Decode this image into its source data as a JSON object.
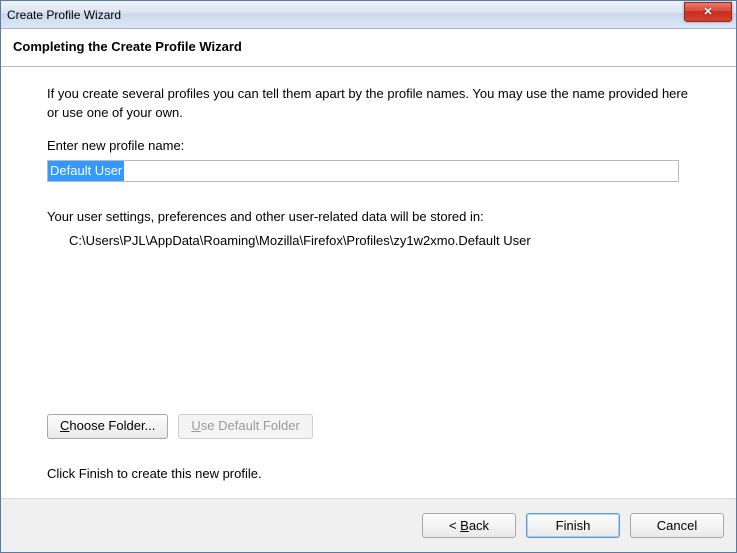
{
  "window": {
    "title": "Create Profile Wizard"
  },
  "header": {
    "subtitle": "Completing the Create Profile Wizard"
  },
  "content": {
    "intro": "If you create several profiles you can tell them apart by the profile names. You may use the name provided here or use one of your own.",
    "profileNameLabel": "Enter new profile name:",
    "profileNameValue": "Default User",
    "storageMessage": "Your user settings, preferences and other user-related data will be stored in:",
    "storagePath": "C:\\Users\\PJL\\AppData\\Roaming\\Mozilla\\Firefox\\Profiles\\zy1w2xmo.Default User",
    "finishNote": "Click Finish to create this new profile."
  },
  "buttons": {
    "chooseFolder": "Choose Folder...",
    "useDefaultFolder": "Use Default Folder",
    "back": "< Back",
    "finish": "Finish",
    "cancel": "Cancel"
  }
}
